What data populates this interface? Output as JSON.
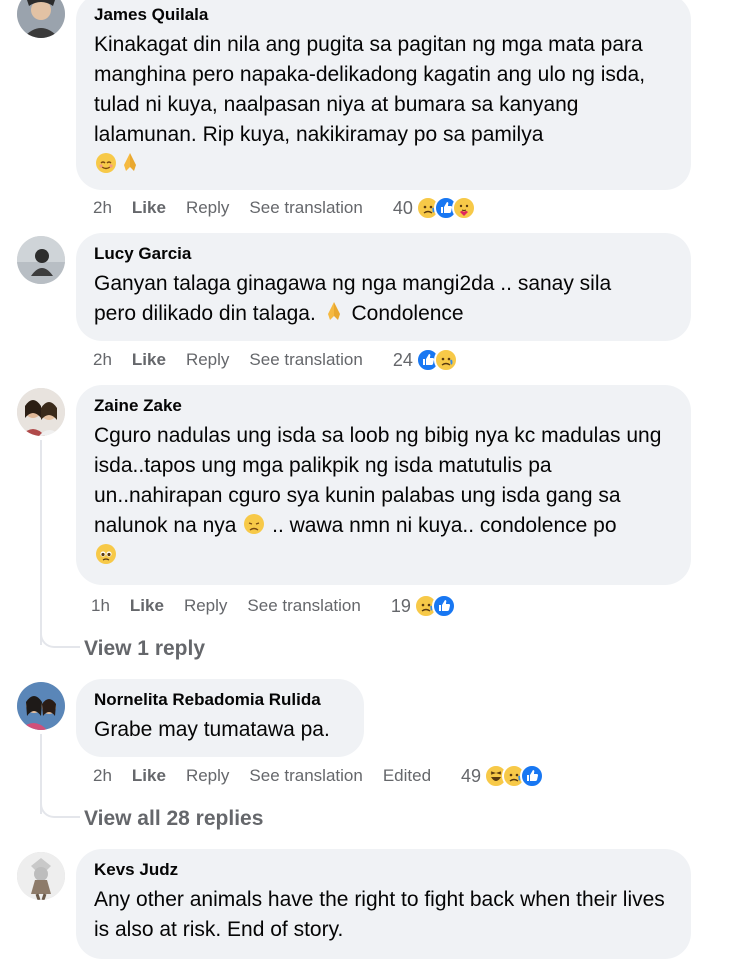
{
  "comments": [
    {
      "author": "James Quilala",
      "text": "Kinakagat din nila ang pugita sa pagitan ng mga mata para manghina pero napaka-delikadong kagatin ang ulo ng isda, tulad ni kuya, naalpasan niya at bumara sa kanyang lalamunan. Rip kuya, nakikiramay po sa pamilya",
      "time": "2h",
      "like": "Like",
      "reply": "Reply",
      "translate": "See translation",
      "reaction_count": "40",
      "reactions": [
        "sad",
        "like",
        "care"
      ]
    },
    {
      "author": "Lucy Garcia",
      "text": "Ganyan talaga ginagawa ng nga mangi2da .. sanay sila pero dilikado din talaga.",
      "text_after": "Condolence",
      "time": "2h",
      "like": "Like",
      "reply": "Reply",
      "translate": "See translation",
      "reaction_count": "24",
      "reactions": [
        "like",
        "sad"
      ]
    },
    {
      "author": "Zaine Zake",
      "text": "Cguro nadulas ung isda sa loob ng bibig nya kc madulas ung isda..tapos ung mga palikpik ng isda matutulis pa un..nahirapan cguro sya kunin palabas ung isda gang sa nalunok na nya",
      "text_after": ".. wawa nmn ni kuya.. condolence po",
      "time": "1h",
      "like": "Like",
      "reply": "Reply",
      "translate": "See translation",
      "reaction_count": "19",
      "reactions": [
        "sad",
        "like"
      ]
    },
    {
      "author": "Nornelita Rebadomia Rulida",
      "text": "Grabe may tumatawa pa.",
      "time": "2h",
      "like": "Like",
      "reply": "Reply",
      "translate": "See translation",
      "edited": "Edited",
      "reaction_count": "49",
      "reactions": [
        "haha",
        "sad",
        "like"
      ]
    },
    {
      "author": "Kevs Judz",
      "text": "Any other animals have the right to fight back when their lives is also at risk. End of story."
    }
  ],
  "view_links": {
    "view_1_reply": "View 1 reply",
    "view_all_replies": "View all 28 replies"
  },
  "colors": {
    "bubble": "#f0f2f5",
    "meta_text": "#65676b",
    "like_blue": "#1877f2",
    "emoji_yellow": "#f7c948"
  }
}
